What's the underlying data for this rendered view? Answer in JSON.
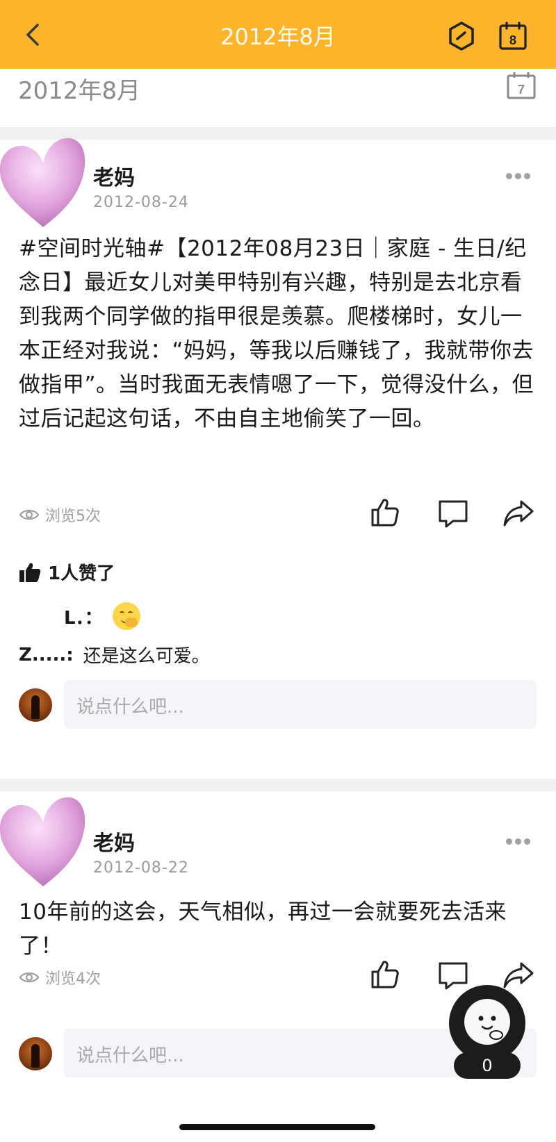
{
  "header": {
    "title": "2012年8月",
    "back_icon": "chevron-left-icon",
    "right_icons": [
      "hexagon-slash-icon",
      "calendar-8-icon"
    ],
    "calendar_day": "8",
    "bg_color": "#fbb42c"
  },
  "subheader": {
    "month_label": "2012年8月",
    "calendar_day": "7"
  },
  "posts": [
    {
      "author": "老妈",
      "date": "2012-08-24",
      "text": "#空间时光轴#【2012年08月23日｜家庭 - 生日/纪念日】最近女儿对美甲特别有兴趣，特别是去北京看到我两个同学做的指甲很是羡慕。爬楼梯时，女儿一本正经对我说：“妈妈，等我以后赚钱了，我就带你去做指甲”。当时我面无表情嗯了一下，觉得没什么，但过后记起这句话，不由自主地偷笑了一回。",
      "views": "浏览5次",
      "likes": "1人赞了",
      "comments": [
        {
          "name": "L．：",
          "text": ""
        },
        {
          "name": "Z.....:",
          "text": "还是这么可爱。"
        }
      ],
      "reply_placeholder": "说点什么吧..."
    },
    {
      "author": "老妈",
      "date": "2012-08-22",
      "text": "10年前的这会，天气相似，再过一会就要死去活来了！",
      "views": "浏览4次",
      "reply_placeholder": "说点什么吧..."
    }
  ],
  "floating_button": {
    "count": "0"
  }
}
